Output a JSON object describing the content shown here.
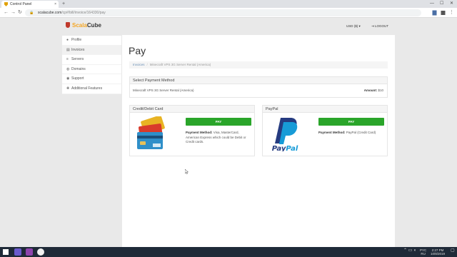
{
  "browser": {
    "tab_title": "Control Panel",
    "tab_close": "×",
    "new_tab": "+",
    "url_domain": "scalacube.com",
    "url_path": "/cp#/bill/invoice/164330/pay",
    "lock_glyph": "🔒"
  },
  "header": {
    "logo_scala": "Scala",
    "logo_cube": "Cube",
    "currency": "USD ($) ▾",
    "logout": "LOGOUT"
  },
  "sidebar": {
    "items": [
      {
        "label": "Profile",
        "icon": "user-icon"
      },
      {
        "label": "Invoices",
        "icon": "invoice-icon"
      },
      {
        "label": "Servers",
        "icon": "server-icon"
      },
      {
        "label": "Domains",
        "icon": "globe-icon"
      },
      {
        "label": "Support",
        "icon": "help-icon"
      },
      {
        "label": "Additional Features",
        "icon": "plugin-icon"
      }
    ]
  },
  "main": {
    "title": "Pay",
    "breadcrumb": {
      "link": "Invoices",
      "sep": "/",
      "current": "Minecraft VPS 3G Server Rental (America)"
    },
    "select_panel": {
      "heading": "Select Payment Method",
      "product": "Minecraft VPS 3G Server Rental (America)",
      "amount_label": "Amount:",
      "amount_value": "$10"
    },
    "credit_card": {
      "heading": "Credit/Debit Card",
      "pay_label": "PAY",
      "method_label": "Payment Method:",
      "method_text": "Visa, MasterCard, American Express which could be Debit or Credit cards."
    },
    "paypal": {
      "heading": "PayPal",
      "pay_label": "PAY",
      "method_label": "Payment Method:",
      "method_text": "PayPal (Credit Card)",
      "logo_text": "PayPal"
    }
  },
  "taskbar": {
    "lang": "PYC",
    "lang2": "RU",
    "time": "2:27 PM",
    "date": "10/8/2019"
  },
  "colors": {
    "pay_green": "#2aa52a",
    "brand_orange": "#f5a623",
    "paypal_dark": "#253b80",
    "paypal_light": "#179bd7"
  }
}
